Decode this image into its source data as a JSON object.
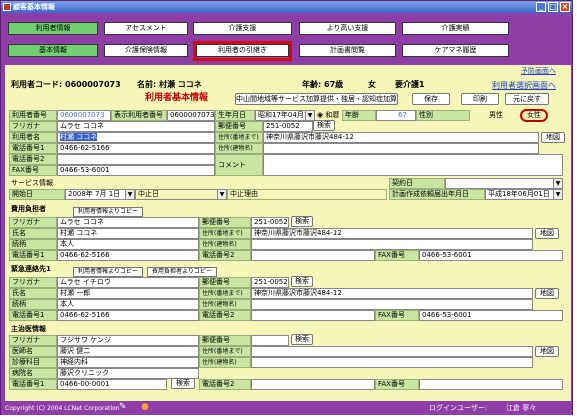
{
  "window": {
    "title": "顧客基本情報"
  },
  "topnav": {
    "row1": [
      "利用者情報",
      "アセスメント",
      "介護支援",
      "より高い支援",
      "介護実績"
    ],
    "row2": [
      "基本情報",
      "介護保険情報",
      "利用者の引継ぎ",
      "計画書閲覧",
      "ケアマネ履歴"
    ],
    "selected_row1": "利用者情報",
    "selected_row2": "基本情報",
    "highlighted": "利用者の引継ぎ"
  },
  "header": {
    "prev_link": "予防画面へ",
    "code_label": "利用者コード:",
    "code": "0600007073",
    "name_label": "名前:",
    "name": "村瀬 ココネ",
    "age_label": "年齢:",
    "age": "67歳",
    "sex": "女",
    "care_level": "要介護1",
    "select_link": "利用者選択画面へ"
  },
  "basic": {
    "title": "利用者基本情報",
    "addon_btn": "中山間地域等サービス加算提供・独居・認知症加算",
    "save": "保存",
    "print": "印刷",
    "back": "元に戻す",
    "no_label": "利用者番号",
    "no_value": "0600007073",
    "disp_no_label": "表示利用者番号",
    "disp_no_value": "0600007073",
    "dob_label": "生年月日",
    "dob_value": "昭和17年04月12日",
    "era": "和暦",
    "age_lbl": "年齢",
    "age_val": "67",
    "sex_label": "性別",
    "male": "男性",
    "female": "女性",
    "kana_label": "フリガナ",
    "kana_value": "ムラセ ココネ",
    "name_label": "利用者名",
    "name_value": "村瀬 ココネ",
    "zip_label": "郵便番号",
    "zip_value": "251-0052",
    "search": "検索",
    "addr1_label": "住所(番地まで)",
    "addr1_value": "神奈川県藤沢市藤沢484-12",
    "addr2_label": "住所(建物名)",
    "tel1_label": "電話番号1",
    "tel1_value": "0466-62-5166",
    "tel2_label": "電話番号2",
    "comment_label": "コメント",
    "fax_label": "FAX番号",
    "fax_value": "0466-53-6001",
    "map": "地図"
  },
  "service": {
    "title": "サービス情報",
    "contract_label": "契約日",
    "start_label": "開始日",
    "start_value": "2008年 7月 1日",
    "pause": "中止日",
    "pause_reason": "中止理由",
    "plan_date_label": "計画作成依頼届出年月日",
    "plan_date_value": "平成18年06月01日"
  },
  "payer": {
    "title": "費用負担者",
    "copy_btn": "利用者情報よりコピー",
    "kana_value": "ムラセ ココネ",
    "name_label": "氏名",
    "name_value": "村瀬 ココネ",
    "rel_label": "続柄",
    "rel_value": "本人",
    "zip_value": "251-0052",
    "addr1_value": "神奈川県藤沢市藤沢484-12",
    "tel1_value": "0466-62-5166",
    "fax_value": "0466-53-6001"
  },
  "emergency": {
    "title": "緊急連絡先1",
    "copy_btn": "利用者情報よりコピー",
    "copy_btn2": "費用負担者よりコピー",
    "kana_value": "ムラセ イチロウ",
    "name_value": "村瀬 一郎",
    "rel_value": "本人",
    "zip_value": "251-0052",
    "addr1_value": "神奈川県藤沢市藤沢484-12",
    "tel1_value": "0466-62-5166",
    "fax_value": "0466-53-6001"
  },
  "doctor": {
    "title": "主治医情報",
    "kana_value": "フジサワ ケンジ",
    "doc_label": "医師名",
    "doc_value": "藤沢 健二",
    "dept_label": "診療科目",
    "dept_value": "神経内科",
    "hosp_label": "病院名",
    "hosp_value": "藤沢クリニック",
    "tel1_value": "0466-00-0001",
    "search": "検索"
  },
  "status": {
    "copyright": "Copyright (C) 2004 LCNet Corporation",
    "login_label": "ログインユーザー:",
    "login_user": "江倉 寧々"
  },
  "colors": {
    "purple": "#8e3ea6",
    "panel": "#f6f6b8",
    "label": "#c8e6a2",
    "highlight": "#e00000",
    "link": "#1a3cc7",
    "title_red": "#c00000"
  }
}
